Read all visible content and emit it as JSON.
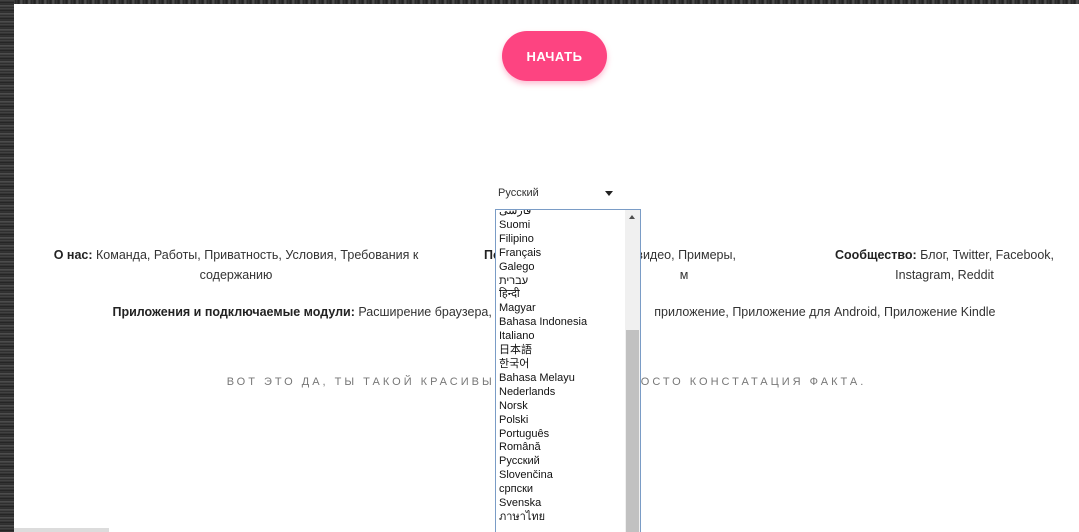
{
  "start_button": {
    "label": "НАЧАТЬ"
  },
  "language_select": {
    "selected": "Русский"
  },
  "footer": {
    "about": {
      "heading": "О нас:",
      "links": "Команда, Работы, Приватность, Условия, Требования к содержанию"
    },
    "support": {
      "heading": "Поддерж",
      "visible_text": "ощие видео, Примеры,",
      "visible_text_2": "м"
    },
    "community": {
      "heading": "Сообщество:",
      "links": "Блог, Twitter, Facebook, Instagram, Reddit"
    },
    "apps": {
      "heading": "Приложения и подключаемые модули:",
      "links_left": "Расширение браузера, П",
      "links_right": "приложение, Приложение для Android, Приложение Kindle"
    },
    "tagline_left": "ВОТ ЭТО ДА, ТЫ ТАКОЙ КРАСИВЫ",
    "tagline_right": "РОСТО КОНСТАТАЦИЯ ФАКТА."
  },
  "dropdown": {
    "options": [
      "فارسی",
      "Suomi",
      "Filipino",
      "Français",
      "Galego",
      "עברית",
      "हिन्दी",
      "Magyar",
      "Bahasa Indonesia",
      "Italiano",
      "日本語",
      "한국어",
      "Bahasa Melayu",
      "Nederlands",
      "Norsk",
      "Polski",
      "Português",
      "Română",
      "Русский",
      "Slovenčina",
      "српски",
      "Svenska",
      "ภาษาไทย"
    ]
  },
  "colors": {
    "accent": "#fd4481",
    "dropdown_border": "#7a9cc6"
  }
}
